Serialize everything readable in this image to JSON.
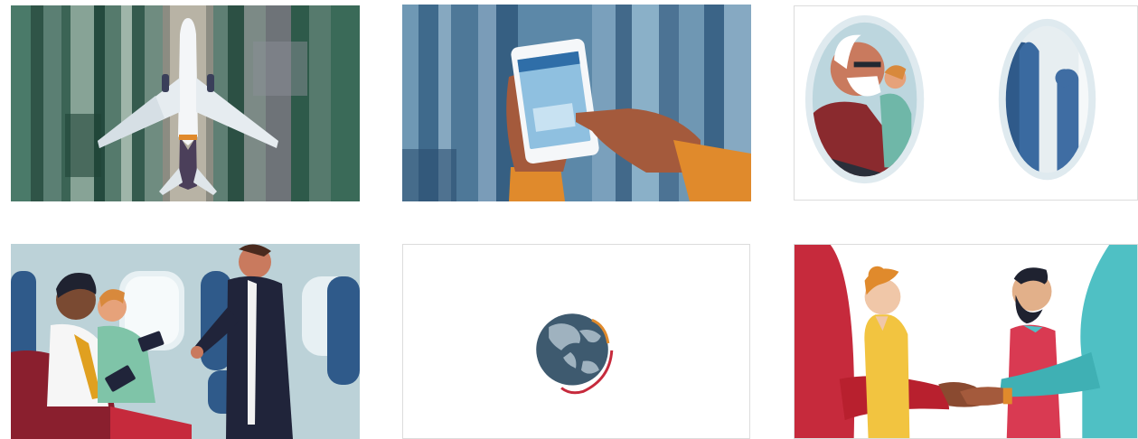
{
  "gallery": {
    "tiles": [
      {
        "icon": "airplane-runway-illustration"
      },
      {
        "icon": "hand-smartphone-illustration"
      },
      {
        "icon": "airplane-window-passengers-illustration"
      },
      {
        "icon": "cabin-passengers-attendant-illustration"
      },
      {
        "icon": "globe-illustration"
      },
      {
        "icon": "handshake-illustration"
      }
    ]
  },
  "colors": {
    "forest_green": "#2f5a4c",
    "steel_blue": "#5c88a8",
    "cabin_blue": "#bcd2d8",
    "accent_red": "#c62a3c",
    "accent_orange": "#e08a2c",
    "teal": "#4fc0c4"
  }
}
